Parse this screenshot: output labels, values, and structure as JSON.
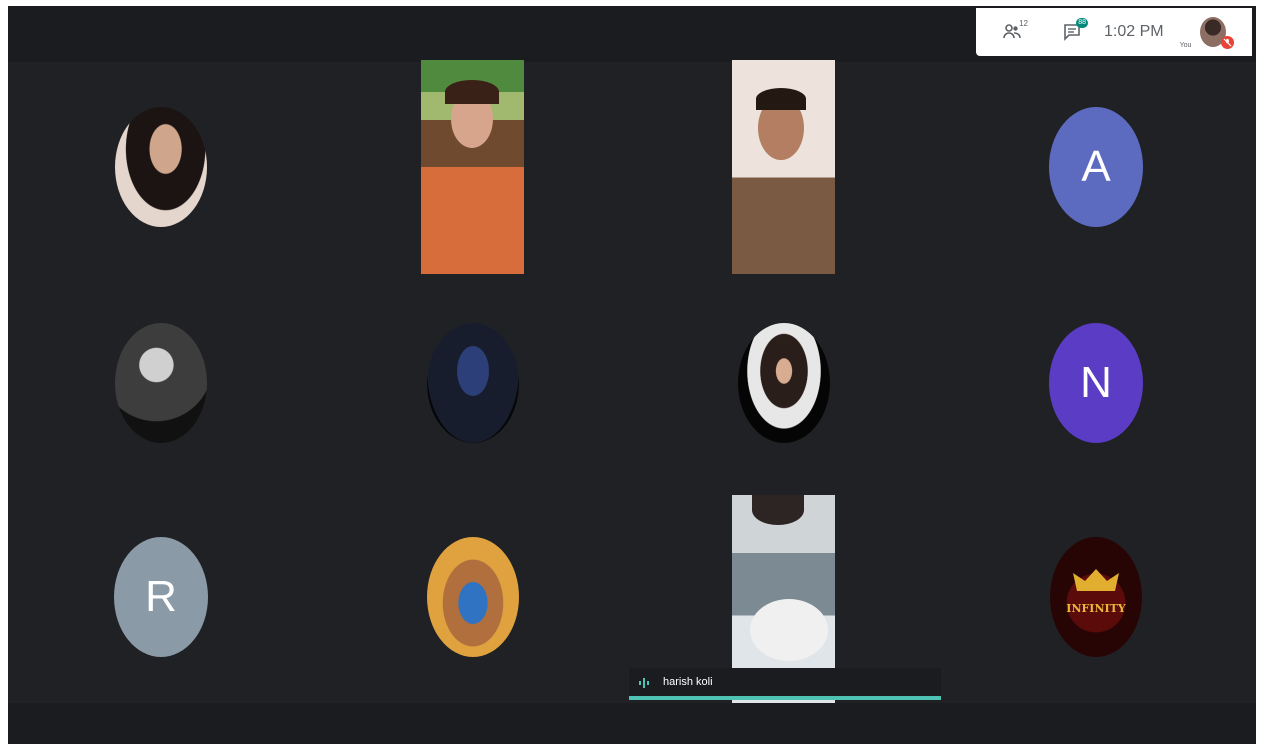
{
  "top_panel": {
    "people_count": "12",
    "chat_count": "88",
    "time": "1:02 PM",
    "self_label": "You",
    "icons": [
      "people-icon",
      "chat-icon",
      "mic-off-icon"
    ]
  },
  "participants": {
    "r2c4": {
      "initial": "N",
      "color": "#5b3cc4"
    },
    "r3c1": {
      "initial": "R",
      "color": "#8a9ba7"
    },
    "r1c4": {
      "initial": "A",
      "color": "#5c6bc0"
    },
    "r3c4": {
      "text": "INFINITY"
    }
  },
  "speaker": {
    "name": "harish koli",
    "accent": "#4ec3b4"
  },
  "colors": {
    "background": "#202124",
    "bars": "#1b1c1f"
  }
}
